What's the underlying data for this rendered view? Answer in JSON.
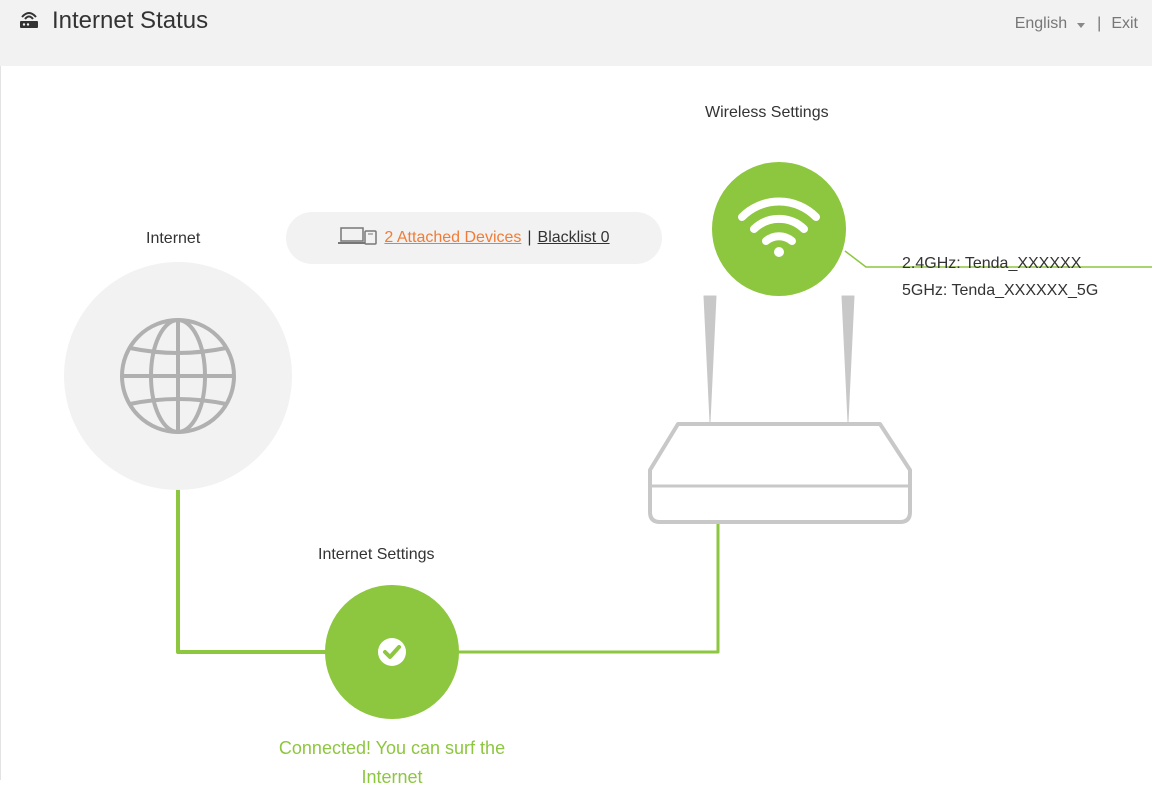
{
  "header": {
    "title": "Internet Status",
    "icon": "router-icon",
    "language": "English",
    "separator": "|",
    "exit": "Exit"
  },
  "internet": {
    "label": "Internet",
    "icon": "globe-icon"
  },
  "devices": {
    "attached_link": "2 Attached Devices ",
    "separator": "|",
    "blacklist_link": "Blacklist 0",
    "icon": "devices-icon"
  },
  "wireless": {
    "label": "Wireless Settings",
    "icon": "wifi-icon",
    "band_24": "2.4GHz: Tenda_XXXXXX",
    "band_5": "5GHz: Tenda_XXXXXX_5G"
  },
  "internet_settings": {
    "label": "Internet Settings",
    "icon": "checkmark-icon",
    "status_line1": "Connected! You can surf the",
    "status_line2": "Internet"
  },
  "colors": {
    "accent_green": "#8dc63f",
    "link_orange": "#f07c37",
    "header_bg": "#f2f2f2"
  }
}
